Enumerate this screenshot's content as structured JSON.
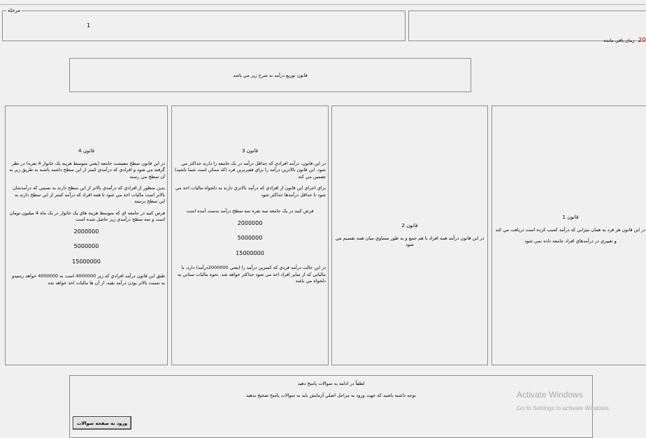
{
  "stage": {
    "legend": "مرحله",
    "value": "1"
  },
  "timer": {
    "value": "20",
    "label": "زمان باقي مانده"
  },
  "intro": {
    "text": "قانون توزيع درآمد به شرح زير مي باشد"
  },
  "laws": {
    "law4": {
      "title": "قانون 4",
      "p1": "در اين قانون سطح معيشت جامعه (يعني متوسط هزينه يک خانوار 4 نفره) در نظر گرفته مي شود و افرادي که درآمدي کمتر از اين سطح داشته باشند به طريق زير به آن سطح مي رسند",
      "p2": "بدين منظور از افرادي که درآمدي بالاتر از اين سطح دارند به نسبتي که درآمدشان بالاتر است ماليات اخذ مي شود تا همه افراد که درآمد کمتر از اين سطح دارند به اين سطح برسند",
      "p3": "فرض کنيد در جامعه اي که متوسط هزينه هاي يک خانوار در يک ماه 4 ميليون تومان است و سه سطح درآمدي زير حاصل شده است",
      "n1": "2000000",
      "n2": "5000000",
      "n3": "15000000",
      "p4": "طبق اين قانون درآمد افرادي که زير 4000000 است به 4000000 خواهد رسيدو به نسبت بالاتر بودن درآمد بقيه، از آن ها ماليات اخذ خواهد شد"
    },
    "law3": {
      "title": "قانون 3",
      "p1": "در اين قانون، درآمد افرادي که حداقل درآمد در يک جامعه را دارند حداکثر مي شود. اين قانون بالاترين درآمد را براي فقيرترين فرد (که ممکن است شما باشيد) تضمين مي کند",
      "p2": "براي اجراي اين قانون از افرادي که درآمد بالاتري دارند به دلخواه ماليات اخذ مي شود تا حداقل درآمدها حداکثر شود",
      "p3": "فرض کنيد در يک جامعه سه نفره سه سطح درآمد بدست آمده است",
      "n1": "2000000",
      "n2": "5000000",
      "n3": "15000000",
      "p4": "در اين حالت درآمد فردي که کمترين درآمد را (يعني 2000000درآمد) دارد، با مالياتي که از ساير افراد اخذ مي شود حداکثر خواهد شد. نحوه ماليات ستاني به دلخواه مي باشد"
    },
    "law2": {
      "title": "قانون 2",
      "p1": "در اين قانون درآمد همه افراد با هم جمع و به طور مساوي ميان همه تقسيم مي شود"
    },
    "law1": {
      "title": "قانون 1",
      "p1": "در اين قانون هر فرد به همان ميزاني که درآمد کسب کرده است دريافت مي کند",
      "p2": "و تغييري در درآمدهاي افراد جامعه داده نمي شود"
    }
  },
  "bottom": {
    "line1": "لطفاً در ادامه به سوالات پاسخ دهيد",
    "line2": "توجه داشته باشيد که جهت ورود به مراحل اصلي آزمايش بايد به سوالات پاسخ صحيح بدهيد",
    "button": "ورود به صفحه سوالات"
  },
  "watermark": {
    "line1": "Activate Windows",
    "line2": "Go to Settings to activate Windows."
  }
}
